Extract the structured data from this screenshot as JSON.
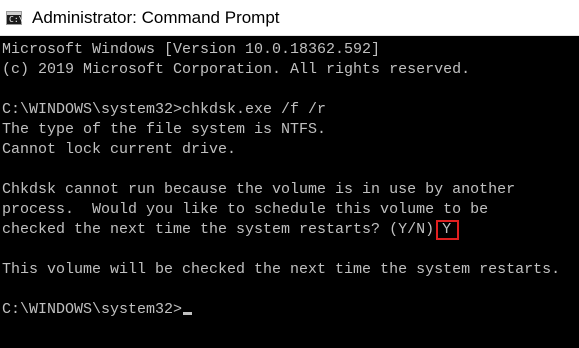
{
  "window": {
    "title": "Administrator: Command Prompt",
    "icon": "cmd-icon",
    "icon_glyph": "C:\\"
  },
  "console": {
    "lines": [
      "Microsoft Windows [Version 10.0.18362.592]",
      "(c) 2019 Microsoft Corporation. All rights reserved.",
      "",
      "C:\\WINDOWS\\system32>chkdsk.exe /f /r",
      "The type of the file system is NTFS.",
      "Cannot lock current drive.",
      "",
      "Chkdsk cannot run because the volume is in use by another",
      "process.  Would you like to schedule this volume to be",
      "checked the next time the system restarts? (Y/N)",
      "",
      "This volume will be checked the next time the system restarts.",
      "",
      "C:\\WINDOWS\\system32>"
    ],
    "answer": "Y",
    "highlight_color": "#e02020"
  }
}
